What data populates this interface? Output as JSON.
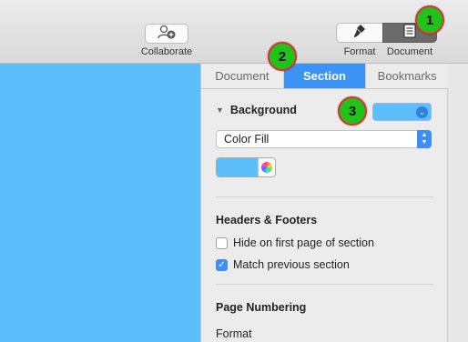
{
  "toolbar": {
    "collaborate_label": "Collaborate",
    "format_label": "Format",
    "document_label": "Document"
  },
  "inspector": {
    "tabs": [
      {
        "label": "Document",
        "active": false
      },
      {
        "label": "Section",
        "active": true
      },
      {
        "label": "Bookmarks",
        "active": false
      }
    ],
    "background": {
      "heading": "Background",
      "fill_type": "Color Fill",
      "color": "#5cbefb"
    },
    "headers_footers": {
      "heading": "Headers & Footers",
      "options": [
        {
          "label": "Hide on first page of section",
          "checked": false
        },
        {
          "label": "Match previous section",
          "checked": true
        }
      ]
    },
    "page_numbering": {
      "heading": "Page Numbering",
      "format_label": "Format"
    }
  },
  "callouts": [
    "1",
    "2",
    "3"
  ],
  "colors": {
    "accent": "#3b8ff5",
    "canvas_background": "#5cbefb",
    "callout_fill": "#21c21a",
    "callout_border": "#d93434"
  }
}
